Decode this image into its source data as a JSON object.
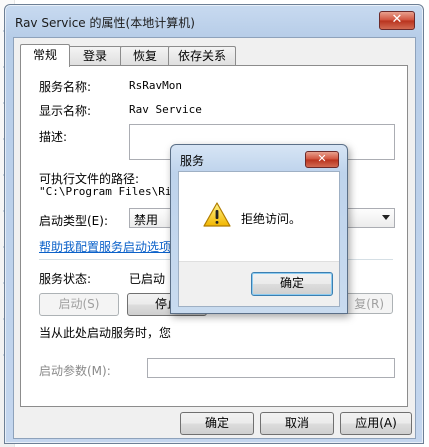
{
  "window": {
    "title": "Rav Service 的属性(本地计算机)",
    "close_glyph": "✕"
  },
  "tabs": [
    {
      "label": "常规"
    },
    {
      "label": "登录"
    },
    {
      "label": "恢复"
    },
    {
      "label": "依存关系"
    }
  ],
  "general": {
    "service_name_label": "服务名称:",
    "service_name_value": "RsRavMon",
    "display_name_label": "显示名称:",
    "display_name_value": "Rav Service",
    "description_label": "描述:",
    "description_value": "",
    "exe_path_label": "可执行文件的路径:",
    "exe_path_value": "\"C:\\Program Files\\Rising",
    "startup_type_label": "启动类型(E):",
    "startup_type_value": "禁用",
    "help_link": "帮助我配置服务启动选项",
    "status_label": "服务状态:",
    "status_value": "已启动",
    "start_button": "启动(S)",
    "stop_button": "停止",
    "resume_button": "复(R)",
    "start_note": "当从此处启动服务时，您",
    "start_params_label": "启动参数(M):",
    "start_params_value": ""
  },
  "footer": {
    "ok": "确定",
    "cancel": "取消",
    "apply": "应用(A)"
  },
  "dialog": {
    "title": "服务",
    "close_glyph": "✕",
    "message": "拒绝访问。",
    "icon": "warning-icon",
    "ok": "确定"
  }
}
